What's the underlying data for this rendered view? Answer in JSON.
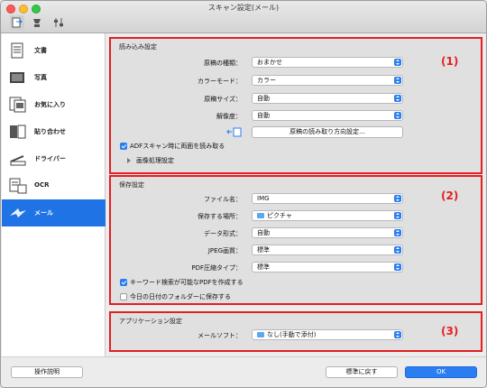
{
  "window": {
    "title": "スキャン設定(メール)"
  },
  "sidebar": {
    "items": [
      {
        "label": "文書",
        "icon": "document-icon"
      },
      {
        "label": "写真",
        "icon": "photo-icon"
      },
      {
        "label": "お気に入り",
        "icon": "favorites-icon"
      },
      {
        "label": "貼り合わせ",
        "icon": "stitch-icon"
      },
      {
        "label": "ドライバー",
        "icon": "driver-icon"
      },
      {
        "label": "OCR",
        "icon": "ocr-icon"
      },
      {
        "label": "メール",
        "icon": "mail-icon",
        "active": true
      }
    ]
  },
  "scan_settings": {
    "title": "読み込み設定",
    "number": "(1)",
    "rows": [
      {
        "label": "原稿の種類：",
        "value": "おまかせ"
      },
      {
        "label": "カラーモード：",
        "value": "カラー"
      },
      {
        "label": "原稿サイズ：",
        "value": "自動"
      },
      {
        "label": "解像度：",
        "value": "自動"
      }
    ],
    "orientation_button": "原稿の読み取り方向設定...",
    "adf_duplex_label": "ADFスキャン時に両面を読み取る",
    "image_processing_label": "画像処理設定"
  },
  "save_settings": {
    "title": "保存設定",
    "number": "(2)",
    "rows": [
      {
        "label": "ファイル名：",
        "value": "IMG"
      },
      {
        "label": "保存する場所：",
        "value": "ピクチャ"
      },
      {
        "label": "データ形式：",
        "value": "自動"
      },
      {
        "label": "JPEG画質：",
        "value": "標準"
      },
      {
        "label": "PDF圧縮タイプ：",
        "value": "標準"
      }
    ],
    "keyword_pdf_label": "キーワード検索が可能なPDFを作成する",
    "date_folder_label": "今日の日付のフォルダーに保存する"
  },
  "app_settings": {
    "title": "アプリケーション設定",
    "number": "(3)",
    "mail_label": "メールソフト：",
    "mail_value": "なし(手動で添付)"
  },
  "footer": {
    "help_label": "操作説明",
    "defaults_label": "標準に戻す",
    "ok_label": "OK"
  },
  "colors": {
    "accent": "#2a7ef2",
    "highlight": "#e41f1f",
    "active_sidebar": "#1f73e4"
  }
}
